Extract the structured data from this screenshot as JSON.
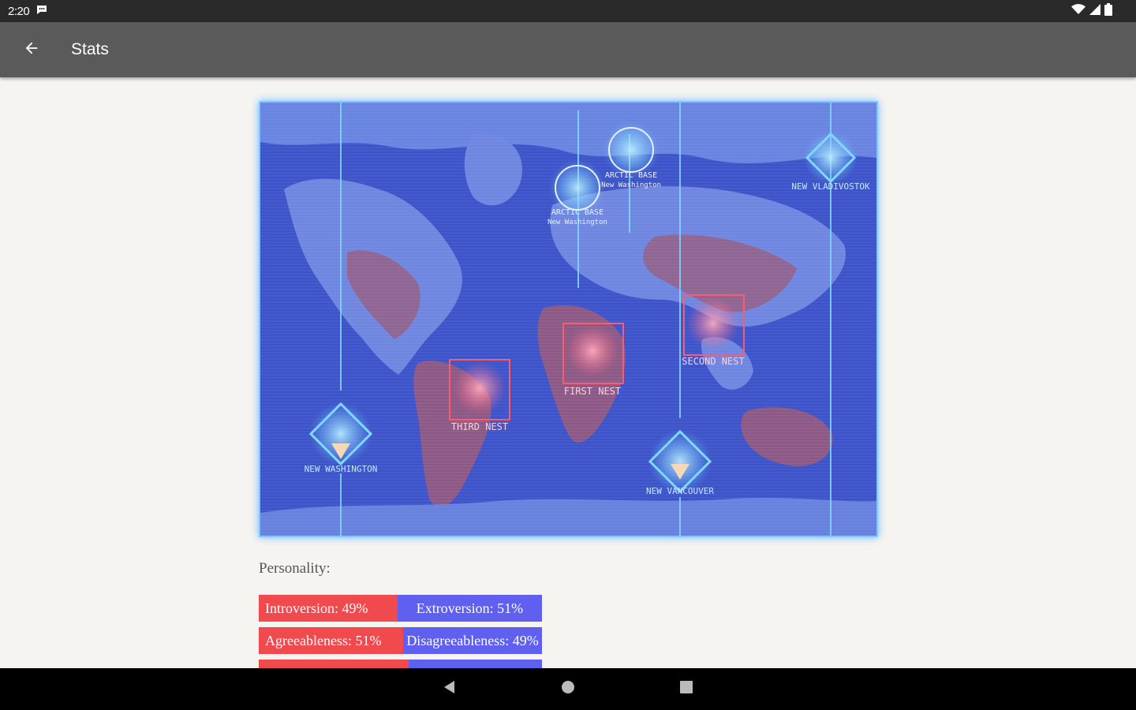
{
  "status_bar": {
    "time": "2:20"
  },
  "app_bar": {
    "title": "Stats"
  },
  "map": {
    "labels": {
      "arctic_base_1": "ARCTIC BASE",
      "arctic_base_1_sub": "New Washington",
      "arctic_base_2": "ARCTIC BASE",
      "arctic_base_2_sub": "New Washington",
      "new_vladivostok": "NEW VLADIVOSTOK",
      "first_nest": "FIRST NEST",
      "second_nest": "SECOND NEST",
      "third_nest": "THIRD NEST",
      "new_washington": "NEW WASHINGTON",
      "new_vancouver": "NEW VANCOUVER"
    },
    "colors": {
      "ocean": "#3d53c9",
      "land": "#6f86e0",
      "infested": "#9a5a7a",
      "grid": "#7fd8ff",
      "nest": "#ff5a6a"
    }
  },
  "personality": {
    "label": "Personality:",
    "traits": [
      {
        "left": "Introversion: 49%",
        "right": "Extroversion: 51%",
        "left_percent": 49
      },
      {
        "left": "Agreeableness: 51%",
        "right": "Disagreeableness: 49%",
        "left_percent": 51
      },
      {
        "left": "",
        "right": "",
        "left_percent": 53
      }
    ],
    "colors": {
      "left": "#f04a4f",
      "right": "#6060f0"
    }
  }
}
